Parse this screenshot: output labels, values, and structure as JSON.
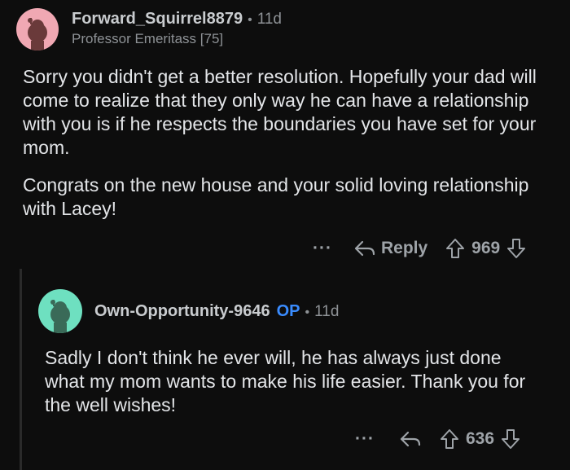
{
  "comment1": {
    "username": "Forward_Squirrel8879",
    "time": "11d",
    "flair": "Professor Emeritass [75]",
    "avatar_color": "#f0a8b3",
    "paragraphs": [
      "Sorry you didn't get a better resolution. Hopefully your dad will come to realize that they only way he can have a relationship with you is if he respects the boundaries you have set for your mom.",
      "Congrats on the new house and your solid loving relationship with Lacey!"
    ],
    "more_label": "···",
    "reply_label": "Reply",
    "votes": "969"
  },
  "comment2": {
    "username": "Own-Opportunity-9646",
    "op_badge": "OP",
    "time": "11d",
    "avatar_color": "#6ee0c0",
    "paragraphs": [
      "Sadly I don't think he ever will, he has always just done what my mom wants to make his life easier. Thank you for the well wishes!"
    ],
    "more_label": "···",
    "votes": "636"
  },
  "icons": {
    "reply": "reply-arrow-icon",
    "upvote": "upvote-arrow-icon",
    "downvote": "downvote-arrow-icon"
  },
  "colors": {
    "background": "#0d0d0d",
    "op_badge": "#3a8cff",
    "text": "#e3e5e8",
    "muted": "#8e9296"
  }
}
